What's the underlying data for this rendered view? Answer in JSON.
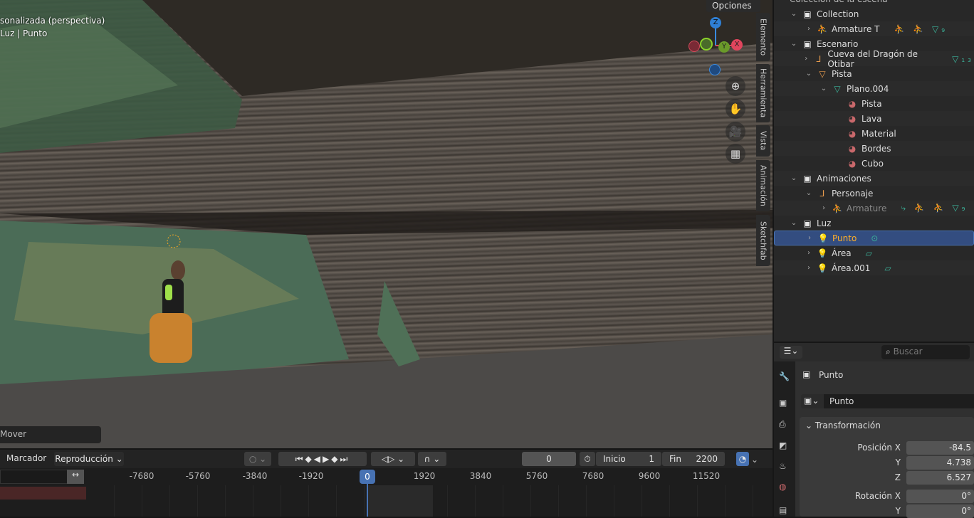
{
  "viewport": {
    "title": "sonalizada (perspectiva)",
    "subtitle": "Luz | Punto",
    "options_label": "Opciones",
    "operator_panel": "Mover",
    "gizmo": {
      "z": "Z",
      "y": "Y",
      "x": "X"
    },
    "side_tabs": [
      "Elemento",
      "Herramienta",
      "Vista",
      "Animación",
      "Sketchfab"
    ],
    "nav_icons": [
      "zoom-icon",
      "hand-pan-icon",
      "camera-icon",
      "grid-perspective-icon"
    ]
  },
  "outliner": {
    "header": "Colección de la escena",
    "rows": [
      {
        "label": "Collection",
        "level": 0,
        "expanded": true,
        "icon": "collection",
        "extras": ""
      },
      {
        "label": "Armature T",
        "level": 1,
        "expanded": false,
        "icon": "armature",
        "extras": "⛹ ⛹ ▽₉"
      },
      {
        "label": "Escenario",
        "level": 0,
        "expanded": true,
        "icon": "collection",
        "extras": ""
      },
      {
        "label": "Cueva del Dragón de Otibar",
        "level": 1,
        "expanded": false,
        "icon": "empty",
        "extras": "▽₁₃"
      },
      {
        "label": "Pista",
        "level": 1,
        "expanded": true,
        "icon": "mesh",
        "extras": ""
      },
      {
        "label": "Plano.004",
        "level": 2,
        "expanded": true,
        "icon": "meshdata",
        "extras": ""
      },
      {
        "label": "Pista",
        "level": 3,
        "icon": "material",
        "extras": ""
      },
      {
        "label": "Lava",
        "level": 3,
        "icon": "material",
        "extras": ""
      },
      {
        "label": "Material",
        "level": 3,
        "icon": "material",
        "extras": ""
      },
      {
        "label": "Bordes",
        "level": 3,
        "icon": "material",
        "extras": ""
      },
      {
        "label": "Cubo",
        "level": 3,
        "icon": "material",
        "extras": ""
      },
      {
        "label": "Animaciones",
        "level": 0,
        "expanded": true,
        "icon": "collection",
        "extras": ""
      },
      {
        "label": "Personaje",
        "level": 1,
        "expanded": true,
        "icon": "empty",
        "extras": ""
      },
      {
        "label": "Armature",
        "level": 2,
        "expanded": false,
        "icon": "armature",
        "extras": "⤷ ⛹ ⛹ ▽₉",
        "dim": true
      },
      {
        "label": "Luz",
        "level": 0,
        "expanded": true,
        "icon": "collection",
        "extras": ""
      },
      {
        "label": "Punto",
        "level": 1,
        "expanded": false,
        "icon": "light",
        "extras": "⊙",
        "selected": true
      },
      {
        "label": "Área",
        "level": 1,
        "expanded": false,
        "icon": "light",
        "extras": "▱"
      },
      {
        "label": "Área.001",
        "level": 1,
        "expanded": false,
        "icon": "light",
        "extras": "▱"
      }
    ]
  },
  "properties": {
    "search_placeholder": "Buscar",
    "object_name": "Punto",
    "datablock_name": "Punto",
    "panel": "Transformación",
    "position_label": "Posición X",
    "rotation_label": "Rotación X",
    "y_label": "Y",
    "z_label": "Z",
    "position": {
      "x": "-84.5",
      "y": "4.738",
      "z": "6.527"
    },
    "rotation": {
      "x": "0°",
      "y": "0°"
    }
  },
  "timeline": {
    "marker_menu": "Marcador",
    "playback_menu": "Reproducción",
    "current_frame": "0",
    "start_label": "Inicio",
    "start": "1",
    "end_label": "Fin",
    "end": "2200",
    "ticks": [
      "-7680",
      "-5760",
      "-3840",
      "-1920",
      "1920",
      "3840",
      "5760",
      "7680",
      "9600",
      "11520"
    ],
    "playhead": "0"
  },
  "colors": {
    "accent": "#4772b3",
    "selected_text": "#ffaf29",
    "object_orange": "#e69a4c",
    "data_green": "#3bb39a",
    "material_red": "#c9686b"
  }
}
